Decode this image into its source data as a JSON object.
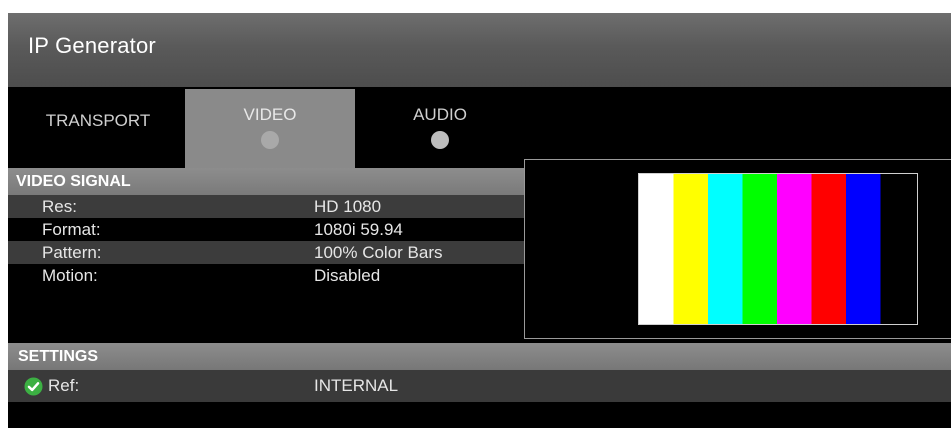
{
  "window": {
    "title": "IP Generator"
  },
  "tabs": [
    {
      "label": "TRANSPORT",
      "active": false,
      "has_indicator": false
    },
    {
      "label": "VIDEO",
      "active": true,
      "has_indicator": true
    },
    {
      "label": "AUDIO",
      "active": false,
      "has_indicator": true
    }
  ],
  "video_signal": {
    "header": "VIDEO SIGNAL",
    "rows": [
      {
        "label": "Res:",
        "value": "HD 1080"
      },
      {
        "label": "Format:",
        "value": "1080i 59.94"
      },
      {
        "label": "Pattern:",
        "value": "100% Color Bars"
      },
      {
        "label": "Motion:",
        "value": "Disabled"
      }
    ]
  },
  "preview": {
    "bars": [
      "#ffffff",
      "#ffff00",
      "#00ffff",
      "#00ff00",
      "#ff00ff",
      "#ff0000",
      "#0000ff",
      "#000000"
    ]
  },
  "settings": {
    "header": "SETTINGS",
    "rows": [
      {
        "label": "Ref:",
        "value": "INTERNAL",
        "status_icon": "check-circle-icon",
        "status_color": "#3cb043"
      }
    ]
  },
  "colors": {
    "titlebar": "#5a5a5a",
    "active_tab": "#8a8a8a",
    "section_header": "#828282",
    "row_alt": "#3c3c3c"
  }
}
